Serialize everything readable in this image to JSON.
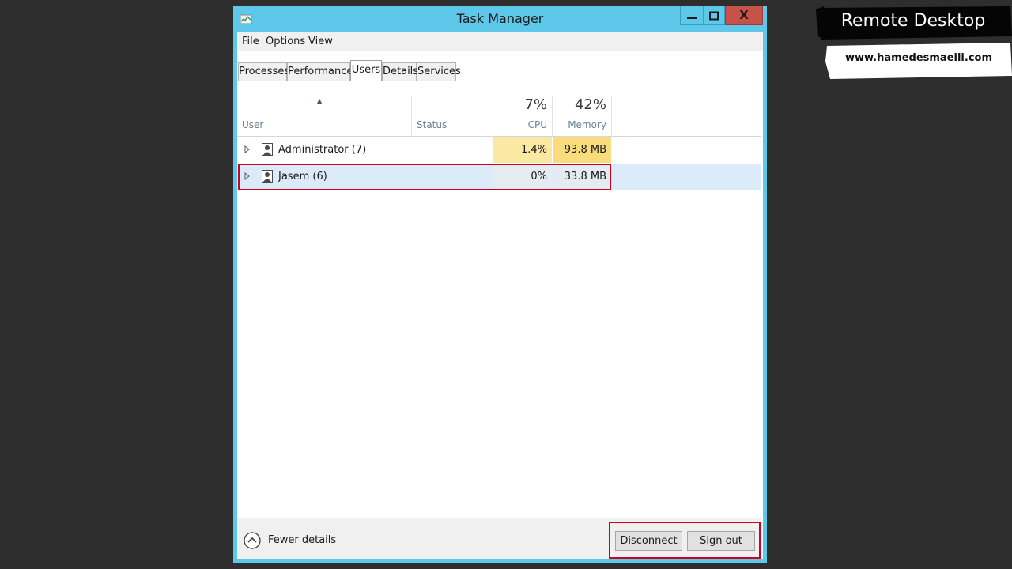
{
  "window": {
    "title": "Task Manager",
    "close_glyph": "X"
  },
  "menu": [
    "File",
    "Options",
    "View"
  ],
  "tabs": [
    {
      "label": "Processes",
      "active": false
    },
    {
      "label": "Performance",
      "active": false
    },
    {
      "label": "Users",
      "active": true
    },
    {
      "label": "Details",
      "active": false
    },
    {
      "label": "Services",
      "active": false
    }
  ],
  "table": {
    "sort_indicator": "▲",
    "columns": {
      "user": "User",
      "status": "Status",
      "cpu": "CPU",
      "cpu_total": "7%",
      "memory": "Memory",
      "memory_total": "42%"
    },
    "rows": [
      {
        "user": "Administrator (7)",
        "status": "",
        "cpu": "1.4%",
        "memory": "93.8 MB",
        "selected": false
      },
      {
        "user": "Jasem (6)",
        "status": "",
        "cpu": "0%",
        "memory": "33.8 MB",
        "selected": true
      }
    ]
  },
  "footer": {
    "fewer_details": "Fewer details",
    "disconnect": "Disconnect",
    "sign_out": "Sign out"
  },
  "banner": {
    "title": "Remote Desktop",
    "url": "www.hamedesmaeili.com"
  },
  "colors": {
    "frame": "#5ec8ea",
    "close_button": "#c7524a",
    "cpu_heat_admin": "#fbe9a3",
    "memory_heat_admin": "#f9dc7c",
    "selected_row": "#dcebf9",
    "annotation_red": "#d0021b"
  },
  "icons": {
    "app": "task-manager-icon",
    "minimize": "minimize-icon",
    "maximize": "maximize-icon",
    "close": "close-icon",
    "expand": "expand-triangle-icon",
    "user": "user-icon",
    "collapse": "chevron-up-circle-icon"
  }
}
